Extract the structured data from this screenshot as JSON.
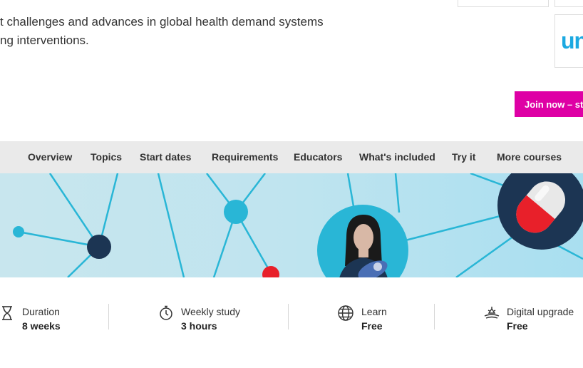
{
  "intro": {
    "text": "t challenges and advances in global health demand systems\nng interventions."
  },
  "partner": {
    "logo_text": "un"
  },
  "cta": {
    "join_label": "Join now – st"
  },
  "nav": {
    "items": [
      {
        "label": "Overview"
      },
      {
        "label": "Topics"
      },
      {
        "label": "Start dates"
      },
      {
        "label": "Requirements"
      },
      {
        "label": "Educators"
      },
      {
        "label": "What's included"
      },
      {
        "label": "Try it"
      },
      {
        "label": "More courses"
      }
    ]
  },
  "banner": {
    "icons": [
      "network-illustration",
      "mother-baby-icon",
      "pill-capsule-icon"
    ],
    "colors": {
      "background": "#b8e2ee",
      "line": "#29b6d6",
      "node_dark": "#1c3553",
      "node_light": "#29b6d6",
      "node_red": "#e8202a"
    }
  },
  "facts": [
    {
      "icon": "hourglass-icon",
      "label": "Duration",
      "value": "8 weeks"
    },
    {
      "icon": "stopwatch-icon",
      "label": "Weekly study",
      "value": "3 hours"
    },
    {
      "icon": "globe-icon",
      "label": "Learn",
      "value": "Free"
    },
    {
      "icon": "digital-upgrade-icon",
      "label": "Digital upgrade",
      "value": "Free"
    }
  ],
  "colors": {
    "accent": "#de00a5",
    "brand_blue": "#1ca9e1",
    "nav_bg": "#eaeaea"
  }
}
